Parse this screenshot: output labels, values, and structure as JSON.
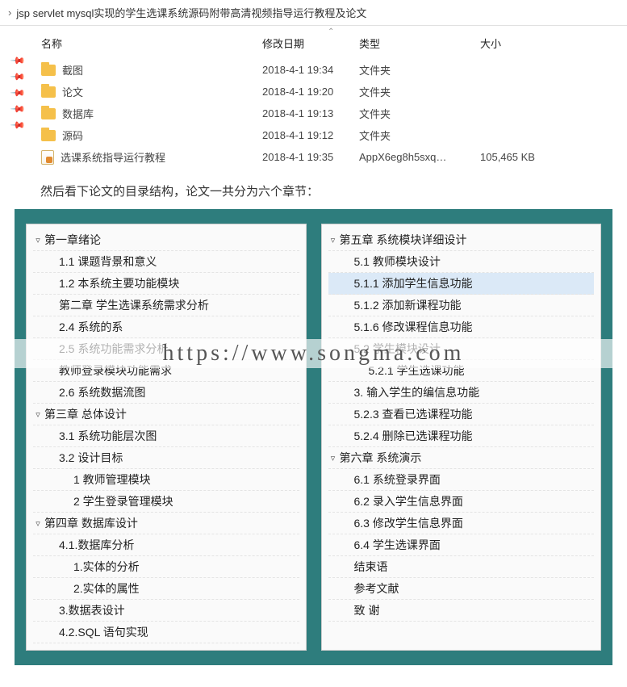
{
  "breadcrumb": {
    "title": "jsp servlet mysql实现的学生选课系统源码附带高清视频指导运行教程及论文"
  },
  "columns": {
    "name": "名称",
    "date": "修改日期",
    "type": "类型",
    "size": "大小"
  },
  "files": [
    {
      "icon": "folder",
      "name": "截图",
      "date": "2018-4-1 19:34",
      "type": "文件夹",
      "size": ""
    },
    {
      "icon": "folder",
      "name": "论文",
      "date": "2018-4-1 19:20",
      "type": "文件夹",
      "size": ""
    },
    {
      "icon": "folder",
      "name": "数据库",
      "date": "2018-4-1 19:13",
      "type": "文件夹",
      "size": ""
    },
    {
      "icon": "folder",
      "name": "源码",
      "date": "2018-4-1 19:12",
      "type": "文件夹",
      "size": ""
    },
    {
      "icon": "doc",
      "name": "选课系统指导运行教程",
      "date": "2018-4-1 19:35",
      "type": "AppX6eg8h5sxq…",
      "size": "105,465 KB"
    }
  ],
  "note": "然后看下论文的目录结构，论文一共分为六个章节：",
  "watermark": "https://www.songma.com",
  "left_tree": [
    {
      "level": 0,
      "caret": "▿",
      "text": "第一章绪论"
    },
    {
      "level": 1,
      "caret": "",
      "text": "1.1 课题背景和意义"
    },
    {
      "level": 1,
      "caret": "",
      "text": "1.2 本系统主要功能模块"
    },
    {
      "level": 1,
      "caret": "",
      "text": "第二章  学生选课系统需求分析"
    },
    {
      "level": 1,
      "caret": "",
      "text": "2.4 系统的系"
    },
    {
      "level": 1,
      "caret": "",
      "text": "2.5 系统功能需求分析"
    },
    {
      "level": 1,
      "caret": "",
      "text": "教师登录模块功能需求"
    },
    {
      "level": 1,
      "caret": "",
      "text": "2.6 系统数据流图"
    },
    {
      "level": 0,
      "caret": "▿",
      "text": "第三章  总体设计"
    },
    {
      "level": 1,
      "caret": "",
      "text": "3.1 系统功能层次图"
    },
    {
      "level": 1,
      "caret": "",
      "text": "3.2 设计目标"
    },
    {
      "level": 2,
      "caret": "",
      "text": "1 教师管理模块"
    },
    {
      "level": 2,
      "caret": "",
      "text": "2 学生登录管理模块"
    },
    {
      "level": 0,
      "caret": "▿",
      "text": "第四章  数据库设计"
    },
    {
      "level": 1,
      "caret": "",
      "text": "4.1.数据库分析"
    },
    {
      "level": 2,
      "caret": "",
      "text": "1.实体的分析"
    },
    {
      "level": 2,
      "caret": "",
      "text": "2.实体的属性"
    },
    {
      "level": 1,
      "caret": "",
      "text": "3.数据表设计"
    },
    {
      "level": 1,
      "caret": "",
      "text": "4.2.SQL 语句实现"
    }
  ],
  "right_tree": [
    {
      "level": 0,
      "caret": "▿",
      "text": "第五章  系统模块详细设计"
    },
    {
      "level": 1,
      "caret": "",
      "text": "5.1 教师模块设计"
    },
    {
      "level": 1,
      "caret": "",
      "text": "5.1.1 添加学生信息功能",
      "sel": true
    },
    {
      "level": 1,
      "caret": "",
      "text": "5.1.2 添加新课程功能"
    },
    {
      "level": 1,
      "caret": "",
      "text": "5.1.6 修改课程信息功能"
    },
    {
      "level": 1,
      "caret": "",
      "text": "5.2 学生模块设计"
    },
    {
      "level": 2,
      "caret": "",
      "text": "5.2.1 学生选课功能"
    },
    {
      "level": 1,
      "caret": "",
      "text": "3. 输入学生的编信息功能"
    },
    {
      "level": 1,
      "caret": "",
      "text": "5.2.3 查看已选课程功能"
    },
    {
      "level": 1,
      "caret": "",
      "text": "5.2.4 删除已选课程功能"
    },
    {
      "level": 0,
      "caret": "▿",
      "text": "第六章  系统演示"
    },
    {
      "level": 1,
      "caret": "",
      "text": "6.1 系统登录界面"
    },
    {
      "level": 1,
      "caret": "",
      "text": "6.2 录入学生信息界面"
    },
    {
      "level": 1,
      "caret": "",
      "text": "6.3 修改学生信息界面"
    },
    {
      "level": 1,
      "caret": "",
      "text": "6.4 学生选课界面"
    },
    {
      "level": 1,
      "caret": "",
      "text": "结束语"
    },
    {
      "level": 1,
      "caret": "",
      "text": "参考文献"
    },
    {
      "level": 1,
      "caret": "",
      "text": "致  谢"
    }
  ]
}
